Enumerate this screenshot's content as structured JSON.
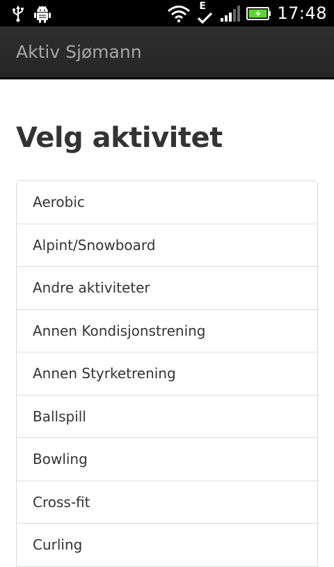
{
  "status_bar": {
    "time": "17:48",
    "icons": [
      "usb-icon",
      "android-debug-icon",
      "wifi-icon",
      "edge-data-icon",
      "signal-icon",
      "battery-charging-icon"
    ],
    "data_label": "E"
  },
  "action_bar": {
    "title": "Aktiv Sjømann"
  },
  "main": {
    "heading": "Velg aktivitet",
    "activities": [
      {
        "label": "Aerobic"
      },
      {
        "label": "Alpint/Snowboard"
      },
      {
        "label": "Andre aktiviteter"
      },
      {
        "label": "Annen Kondisjonstrening"
      },
      {
        "label": "Annen Styrketrening"
      },
      {
        "label": "Ballspill"
      },
      {
        "label": "Bowling"
      },
      {
        "label": "Cross-fit"
      },
      {
        "label": "Curling"
      }
    ]
  },
  "colors": {
    "status_bar_bg": "#000000",
    "action_bar_bg": "#2b2b2b",
    "title_text": "#a8a8a8",
    "heading_text": "#333333",
    "list_text": "#333333",
    "list_border": "#dddddd",
    "battery_fill": "#5cd62e"
  }
}
